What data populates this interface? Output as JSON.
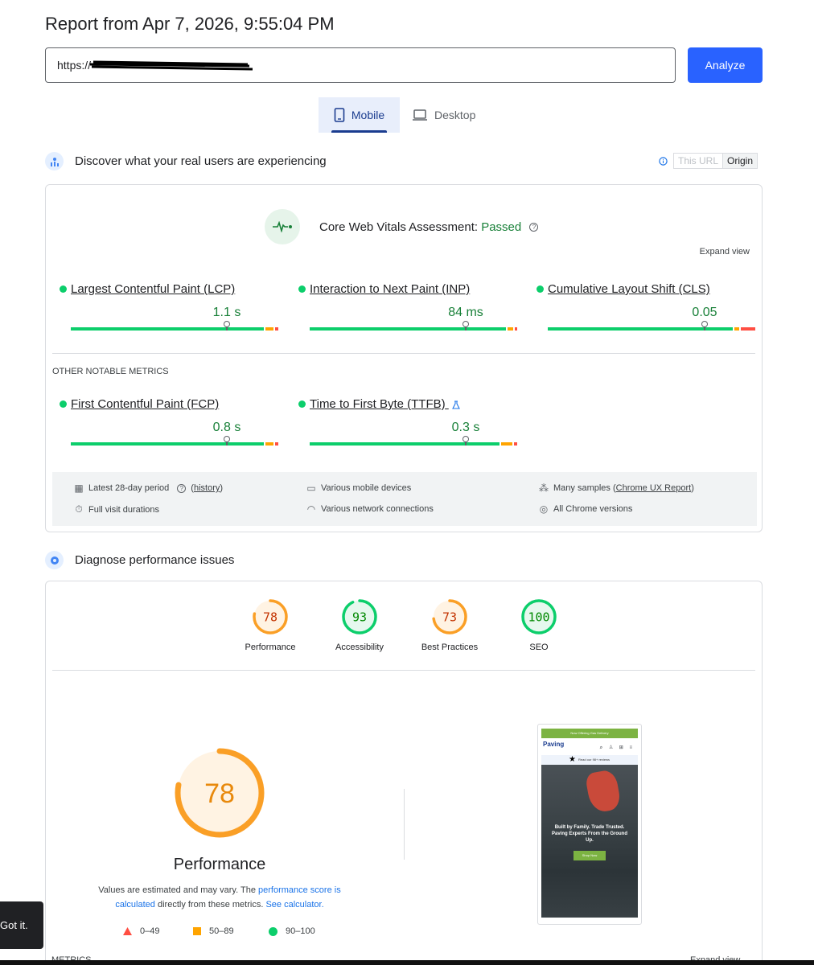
{
  "header": {
    "title": "Report from Apr 7, 2026, 9:55:04 PM"
  },
  "url_input": {
    "value": "https://"
  },
  "analyze_label": "Analyze",
  "tabs": [
    {
      "label": "Mobile"
    },
    {
      "label": "Desktop"
    }
  ],
  "field_data": {
    "heading": "Discover what your real users are experiencing",
    "toggle": {
      "this_url": "This URL",
      "origin": "Origin",
      "selected": "Origin"
    },
    "assessment": {
      "prefix": "Core Web Vitals Assessment:",
      "status": "Passed"
    },
    "expand_label": "Expand view",
    "metrics": [
      {
        "name": "Largest Contentful Paint (LCP)",
        "value": "1.1 s"
      },
      {
        "name": "Interaction to Next Paint (INP)",
        "value": "84 ms"
      },
      {
        "name": "Cumulative Layout Shift (CLS)",
        "value": "0.05"
      }
    ],
    "other_label": "OTHER NOTABLE METRICS",
    "other_metrics": [
      {
        "name": "First Contentful Paint (FCP)",
        "value": "0.8 s"
      },
      {
        "name": "Time to First Byte (TTFB)",
        "value": "0.3 s"
      }
    ],
    "info": {
      "period": "Latest 28-day period",
      "history": "history",
      "devices": "Various mobile devices",
      "samples_prefix": "Many samples (",
      "samples_link": "Chrome UX Report",
      "samples_suffix": ")",
      "durations": "Full visit durations",
      "network": "Various network connections",
      "chrome": "All Chrome versions"
    }
  },
  "diagnose": {
    "heading": "Diagnose performance issues",
    "scores": [
      {
        "label": "Performance",
        "score": 78,
        "color": "#fa9f26"
      },
      {
        "label": "Accessibility",
        "score": 93,
        "color": "#0cce6b"
      },
      {
        "label": "Best Practices",
        "score": 73,
        "color": "#fa9f26"
      },
      {
        "label": "SEO",
        "score": 100,
        "color": "#0cce6b"
      }
    ],
    "big_score": 78,
    "big_label": "Performance",
    "disclaimer": {
      "part1": "Values are estimated and may vary. The ",
      "link1": "performance score is calculated",
      "part2": " directly from these metrics. ",
      "link2": "See calculator."
    },
    "legend": [
      {
        "label": "0–49",
        "color": "#ff4e42"
      },
      {
        "label": "50–89",
        "color": "#ffa400"
      },
      {
        "label": "90–100",
        "color": "#0cce6b"
      }
    ],
    "metrics_label": "METRICS",
    "expand_label": "Expand view",
    "screenshot": {
      "banner": "Now Offering Gas Delivery",
      "logo": "Paving",
      "reviews": "Read our 98+ reviews",
      "hero_text": "Built by Family. Trade Trusted. Paving Experts From the Ground Up.",
      "cta": "Shop Now"
    }
  },
  "toast": {
    "label": "Got it."
  },
  "colors": {
    "accent": "#2962ff",
    "good": "#0cce6b",
    "average": "#ffa400",
    "poor": "#ff4e42"
  }
}
